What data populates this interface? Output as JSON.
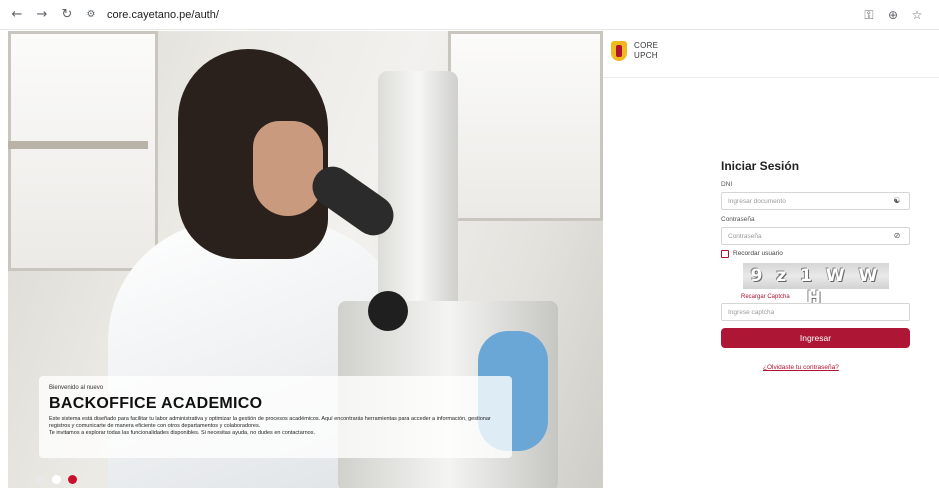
{
  "browser": {
    "url": "core.cayetano.pe/auth/",
    "icons": [
      "back-arrow-icon",
      "forward-arrow-icon",
      "reload-icon",
      "site-settings-icon",
      "password-key-icon",
      "zoom-icon",
      "bookmark-star-icon"
    ]
  },
  "hero": {
    "welcome": "Bienvenido al nuevo",
    "title": "BACKOFFICE ACADEMICO",
    "description_1": "Este sistema está diseñado para facilitar tu labor administrativa y optimizar la gestión de procesos académicos. Aquí encontrarás herramientas para acceder a información, gestionar registros y comunicarte de manera eficiente con otros departamentos y colaboradores.",
    "description_2": "Te invitamos a explorar todas las funcionalidades disponibles. Si necesitas ayuda, no dudes en contactarnos.",
    "slides": [
      {
        "color": "#e8e8e8",
        "active": false
      },
      {
        "color": "#ffffff",
        "active": false
      },
      {
        "color": "#c8102e",
        "active": true
      }
    ]
  },
  "brand": {
    "line1": "CORE",
    "line2": "UPCH"
  },
  "login": {
    "title": "Iniciar Sesión",
    "dni_label": "DNI",
    "dni_placeholder": "Ingresar documento",
    "password_label": "Contraseña",
    "password_placeholder": "Contraseña",
    "remember_label": "Recordar usuario",
    "captcha_text": "9 z 1 W W H",
    "reload_captcha": "Recargar Captcha",
    "captcha_placeholder": "Ingrese captcha",
    "submit": "Ingresar",
    "forgot": "¿Olvidaste tu contraseña?"
  },
  "colors": {
    "accent": "#ad1735",
    "shield": "#f0b91e"
  }
}
